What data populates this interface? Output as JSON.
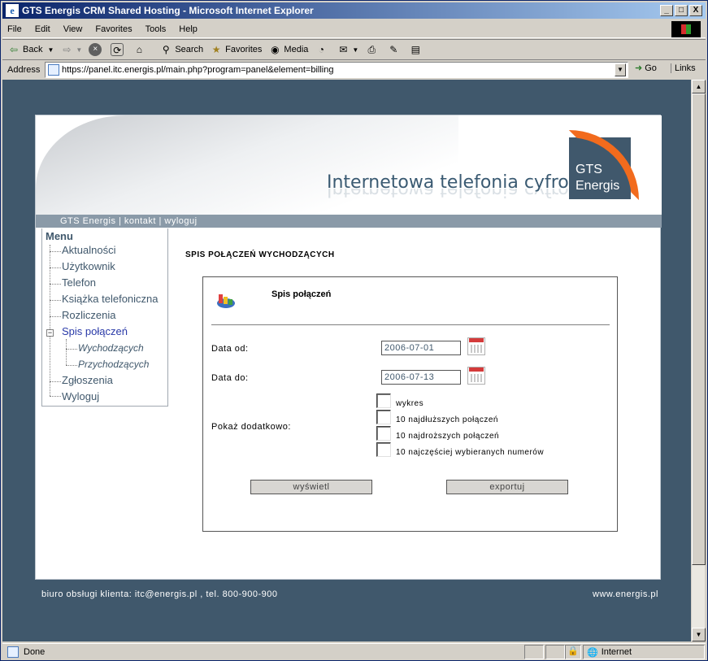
{
  "window": {
    "title": "GTS Energis CRM Shared Hosting - Microsoft Internet Explorer",
    "minimize": "_",
    "maximize": "□",
    "close": "X"
  },
  "menubar": [
    "File",
    "Edit",
    "View",
    "Favorites",
    "Tools",
    "Help"
  ],
  "toolbar": {
    "back": "Back",
    "search": "Search",
    "favorites": "Favorites",
    "media": "Media"
  },
  "address": {
    "label": "Address",
    "url": "https://panel.itc.energis.pl/main.php?program=panel&element=billing",
    "go": "Go",
    "links": "Links"
  },
  "status": {
    "text": "Done",
    "zone": "Internet"
  },
  "header": {
    "slogan": "Internetowa telefonia cyfrowa",
    "logo_line1": "GTS",
    "logo_line2": "Energis",
    "topnav": "GTS Energis | kontakt | wyloguj"
  },
  "sidebar": {
    "title": "Menu",
    "items": [
      {
        "label": "Aktualności"
      },
      {
        "label": "Użytkownik"
      },
      {
        "label": "Telefon"
      },
      {
        "label": "Książka telefoniczna"
      },
      {
        "label": "Rozliczenia"
      },
      {
        "label": "Spis połączeń"
      },
      {
        "label": "Wychodzących"
      },
      {
        "label": "Przychodzących"
      },
      {
        "label": "Zgłoszenia"
      },
      {
        "label": "Wyloguj"
      }
    ],
    "expander": "−"
  },
  "main": {
    "heading": "SPIS POŁĄCZEŃ WYCHODZĄCYCH",
    "box_title": "Spis połączeń",
    "date_from_label": "Data od:",
    "date_from": "2006-07-01",
    "date_to_label": "Data do:",
    "date_to": "2006-07-13",
    "extra_label": "Pokaż dodatkowo:",
    "options": [
      {
        "label": "wykres"
      },
      {
        "label": "10 najdłuższych połączeń"
      },
      {
        "label": "10 najdroższych połączeń"
      },
      {
        "label": "10 najczęściej wybieranych numerów"
      }
    ],
    "show_button": "wyświetl",
    "export_button": "exportuj"
  },
  "footer": {
    "left": "biuro obsługi klienta: itc@energis.pl , tel. 800-900-900",
    "right": "www.energis.pl"
  },
  "colors": {
    "background": "#40586c",
    "accent": "#f26b1d",
    "nav": "#8a9aa8",
    "link_active": "#2a3aa8"
  }
}
